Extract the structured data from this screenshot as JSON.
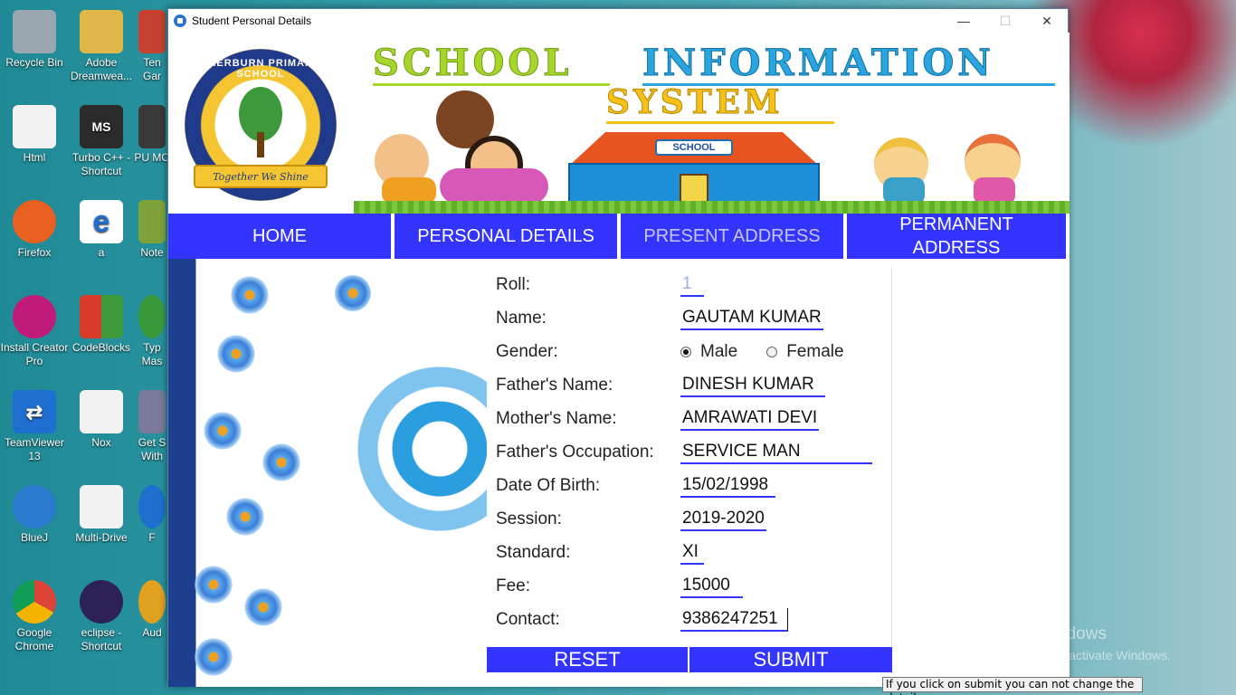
{
  "desktop": {
    "icons": [
      {
        "label": "Recycle Bin",
        "glyph": "🗑",
        "color": "#9aa7b1"
      },
      {
        "label": "Adobe Dreamwea...",
        "glyph": "📁",
        "color": "#e0b84a"
      },
      {
        "label": "Ten Gar",
        "glyph": "",
        "color": "#c84030"
      },
      {
        "label": "Html",
        "glyph": "",
        "color": "#f2f2f2"
      },
      {
        "label": "Turbo C++ - Shortcut",
        "glyph": "MS",
        "color": "#2b2b2b"
      },
      {
        "label": "PU MO",
        "glyph": "",
        "color": "#3a3a3a"
      },
      {
        "label": "Firefox",
        "glyph": "",
        "color": "#e8601f"
      },
      {
        "label": "a",
        "glyph": "e",
        "color": "#1f6fd0"
      },
      {
        "label": "Note",
        "glyph": "",
        "color": "#7fa33a"
      },
      {
        "label": "Install Creator Pro",
        "glyph": "",
        "color": "#c01a7a"
      },
      {
        "label": "CodeBlocks",
        "glyph": "",
        "color": "#3c9a3a"
      },
      {
        "label": "Typ Mas",
        "glyph": "",
        "color": "#3a9a3a"
      },
      {
        "label": "TeamViewer 13",
        "glyph": "⇄",
        "color": "#1f6fd0"
      },
      {
        "label": "Nox",
        "glyph": "",
        "color": "#f2f2f2"
      },
      {
        "label": "Get S With",
        "glyph": "",
        "color": "#7a7a9a"
      },
      {
        "label": "BlueJ",
        "glyph": "",
        "color": "#2a7ad0"
      },
      {
        "label": "Multi-Drive",
        "glyph": "",
        "color": "#f2f2f2"
      },
      {
        "label": "F",
        "glyph": "",
        "color": "#1f6fd0"
      },
      {
        "label": "Google Chrome",
        "glyph": "",
        "color": "#db4437"
      },
      {
        "label": "eclipse - Shortcut",
        "glyph": "",
        "color": "#2c2255"
      },
      {
        "label": "Aud",
        "glyph": "",
        "color": "#e0a020"
      }
    ]
  },
  "window": {
    "title": "Student Personal Details",
    "minimize": "—",
    "maximize": "☐",
    "close": "✕"
  },
  "banner": {
    "school_ring_text": "SHERBURN PRIMARY SCHOOL",
    "motto": "Together We Shine",
    "title_word1": "SCHOOL",
    "title_word2": "INFORMATION",
    "title_word3": "SYSTEM",
    "school_sign": "SCHOOL"
  },
  "nav": {
    "tabs": [
      {
        "label": "HOME"
      },
      {
        "label": "PERSONAL DETAILS"
      },
      {
        "label": "PRESENT ADDRESS"
      },
      {
        "label": "PERMANENT ADDRESS"
      }
    ]
  },
  "form": {
    "roll_label": "Roll:",
    "roll_value": "1",
    "name_label": "Name:",
    "name_value": "GAUTAM KUMAR",
    "gender_label": "Gender:",
    "gender_male": "Male",
    "gender_female": "Female",
    "gender_selected": "Male",
    "father_label": "Father's Name:",
    "father_value": "DINESH KUMAR",
    "mother_label": "Mother's Name:",
    "mother_value": "AMRAWATI DEVI",
    "occupation_label": "Father's Occupation:",
    "occupation_value": "SERVICE MAN",
    "dob_label": "Date Of Birth:",
    "dob_value": "15/02/1998",
    "session_label": "Session:",
    "session_value": "2019-2020",
    "standard_label": "Standard:",
    "standard_value": "XI",
    "fee_label": "Fee:",
    "fee_value": "15000",
    "contact_label": "Contact:",
    "contact_value": "9386247251"
  },
  "actions": {
    "reset": "RESET",
    "submit": "SUBMIT"
  },
  "tooltip": "If you click on submit you can not change the details",
  "activation": {
    "title": "Activate Windows",
    "subtitle": "Go to Settings to activate Windows."
  },
  "colors": {
    "nav_bg": "#3434ff",
    "field_underline": "#3434ff",
    "title_green": "#a7d62a",
    "title_blue": "#2aa5e0",
    "title_yellow": "#f5c018"
  }
}
